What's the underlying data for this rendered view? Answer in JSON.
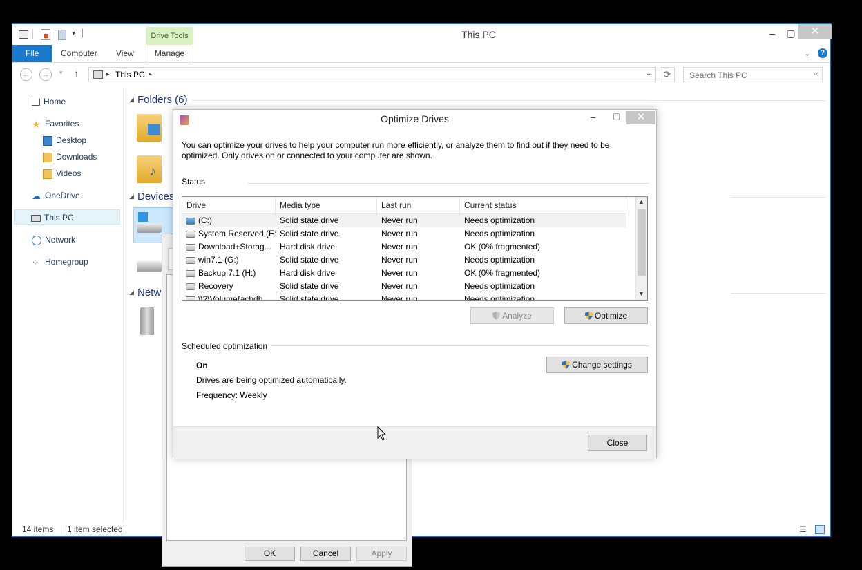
{
  "explorer": {
    "title": "This PC",
    "drive_tools": "Drive Tools",
    "tabs": [
      "File",
      "Computer",
      "View",
      "Manage"
    ],
    "address": "This PC",
    "search_placeholder": "Search This PC",
    "nav": {
      "home": "Home",
      "favorites": "Favorites",
      "desktop": "Desktop",
      "downloads": "Downloads",
      "videos": "Videos",
      "onedrive": "OneDrive",
      "thispc": "This PC",
      "network": "Network",
      "homegroup": "Homegroup"
    },
    "sections": {
      "folders": "Folders (6)",
      "devices": "Devices",
      "network": "Netw"
    },
    "status": {
      "items": "14 items",
      "selected": "1 item selected"
    }
  },
  "properties_dialog": {
    "ok": "OK",
    "cancel": "Cancel",
    "apply": "Apply"
  },
  "optimize": {
    "title": "Optimize Drives",
    "description": "You can optimize your drives to help your computer run more efficiently, or analyze them to find out if they need to be optimized. Only drives on or connected to your computer are shown.",
    "status_label": "Status",
    "columns": [
      "Drive",
      "Media type",
      "Last run",
      "Current status"
    ],
    "rows": [
      {
        "drive": "(C:)",
        "media": "Solid state drive",
        "last": "Never run",
        "status": "Needs optimization"
      },
      {
        "drive": "System Reserved (E:)",
        "media": "Solid state drive",
        "last": "Never run",
        "status": "Needs optimization"
      },
      {
        "drive": "Download+Storag...",
        "media": "Hard disk drive",
        "last": "Never run",
        "status": "OK (0% fragmented)"
      },
      {
        "drive": "win7.1 (G:)",
        "media": "Solid state drive",
        "last": "Never run",
        "status": "Needs optimization"
      },
      {
        "drive": "Backup 7.1 (H:)",
        "media": "Hard disk drive",
        "last": "Never run",
        "status": "OK (0% fragmented)"
      },
      {
        "drive": "Recovery",
        "media": "Solid state drive",
        "last": "Never run",
        "status": "Needs optimization"
      },
      {
        "drive": "\\\\?\\Volume{acbdb...",
        "media": "Solid state drive",
        "last": "Never run",
        "status": "Needs optimization"
      }
    ],
    "analyze": "Analyze",
    "optimize": "Optimize",
    "scheduled_label": "Scheduled optimization",
    "sched_state": "On",
    "sched_desc": "Drives are being optimized automatically.",
    "sched_freq": "Frequency: Weekly",
    "change_settings": "Change settings",
    "close": "Close"
  }
}
